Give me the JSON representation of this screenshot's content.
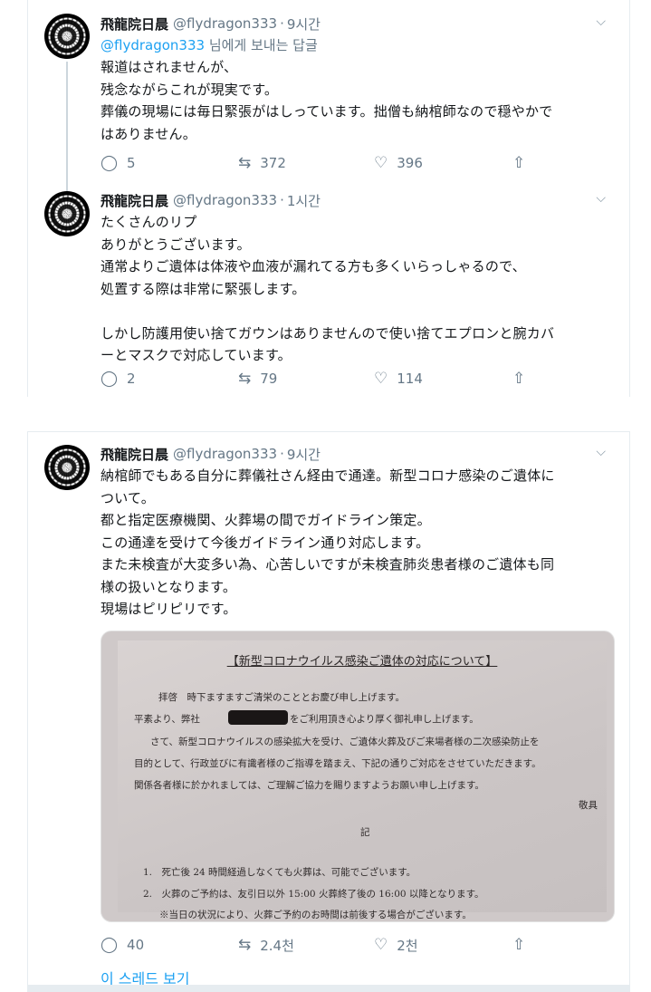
{
  "tweets": [
    {
      "name": "飛龍院日晨",
      "handle": "@flydragon333",
      "time": "9시간",
      "reply_prefix_mention": "@flydragon333",
      "reply_suffix": " 님에게 보내는 답글",
      "lines": [
        "報道はされませんが、",
        "残念ながらこれが現実です。",
        "葬儀の現場には毎日緊張がはしっています。拙僧も納棺師なので穏やかで",
        "はありません。"
      ],
      "replies": "5",
      "retweets": "372",
      "likes": "396"
    },
    {
      "name": "飛龍院日晨",
      "handle": "@flydragon333",
      "time": "1시간",
      "lines": [
        "たくさんのリプ",
        "ありがとうございます。",
        "通常よりご遺体は体液や血液が漏れてる方も多くいらっしゃるので、",
        "処置する際は非常に緊張します。",
        "",
        "しかし防護用使い捨てガウンはありませんので使い捨てエプロンと腕カバ",
        "ーとマスクで対応しています。"
      ],
      "replies": "2",
      "retweets": "79",
      "likes": "114"
    },
    {
      "name": "飛龍院日晨",
      "handle": "@flydragon333",
      "time": "9시간",
      "lines": [
        "納棺師でもある自分に葬儀社さん経由で通達。新型コロナ感染のご遺体に",
        "ついて。",
        "都と指定医療機関、火葬場の間でガイドライン策定。",
        "この通達を受けて今後ガイドライン通り対応します。",
        "また未検査が大変多い為、心苦しいですが未検査肺炎患者様のご遺体も同",
        "様の扱いとなります。",
        "現場はピリピリです。"
      ],
      "replies": "40",
      "retweets": "2.4천",
      "likes": "2천",
      "image": {
        "title": "【新型コロナウイルス感染ご遺体の対応について】",
        "lines": [
          "拝啓　時下ますますご清栄のこととお慶び申し上げます。",
          "平素より、弊社",
          "をご利用頂き心より厚く御礼申し上げます。",
          "さて、新型コロナウイルスの感染拡大を受け、ご遺体火葬及びご来場者様の二次感染防止を",
          "目的として、行政並びに有識者様のご指導を踏まえ、下記の通りご対応をさせていただきます。",
          "関係各者様に於かれましては、ご理解ご協力を賜りますようお願い申し上げます。",
          "敬具",
          "記",
          "1.　死亡後 24 時間経過しなくても火葬は、可能でございます。",
          "2.　火葬のご予約は、友引日以外 15:00 火葬終了後の 16:00 以降となります。",
          "※当日の状況により、火葬ご予約のお時間は前後する場合がございます。"
        ]
      }
    }
  ],
  "show_thread": "이 스레드 보기",
  "icons": {
    "reply": "reply-icon",
    "retweet": "retweet-icon",
    "like": "heart-icon",
    "share": "share-icon",
    "more": "chevron-down-icon"
  },
  "colors": {
    "accent": "#1da1f2",
    "secondary_text": "#657786"
  }
}
